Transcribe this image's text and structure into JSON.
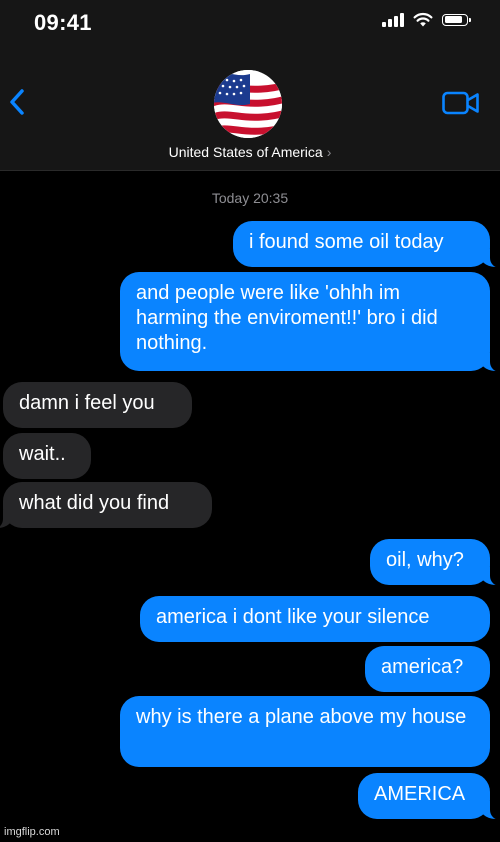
{
  "status_bar": {
    "time": "09:41",
    "icons": [
      "cellular-signal-icon",
      "wifi-icon",
      "battery-icon"
    ],
    "battery_level": 0.85
  },
  "header": {
    "contact_name": "United States of America",
    "chevron": "›",
    "avatar": "american-flag-avatar",
    "icons": [
      "chevron-left-icon",
      "video-camera-icon"
    ],
    "accent_color": "#0a84ff"
  },
  "conversation": {
    "timestamp": "Today 20:35",
    "messages": [
      {
        "side": "sent",
        "text": "i found some oil today"
      },
      {
        "side": "sent",
        "text": "and people were like 'ohhh im harming the enviroment!!' bro i did nothing."
      },
      {
        "side": "received",
        "text": "damn i feel you"
      },
      {
        "side": "received",
        "text": "wait.."
      },
      {
        "side": "received",
        "text": "what did you find"
      },
      {
        "side": "sent",
        "text": "oil, why?"
      },
      {
        "side": "sent",
        "text": "america i dont like your silence"
      },
      {
        "side": "sent",
        "text": "america?"
      },
      {
        "side": "sent",
        "text": "why is there a plane above my house"
      },
      {
        "side": "sent",
        "text": "AMERICA"
      }
    ],
    "colors": {
      "sent": "#0a84ff",
      "received": "#262628"
    }
  },
  "watermark": "imgflip.com"
}
